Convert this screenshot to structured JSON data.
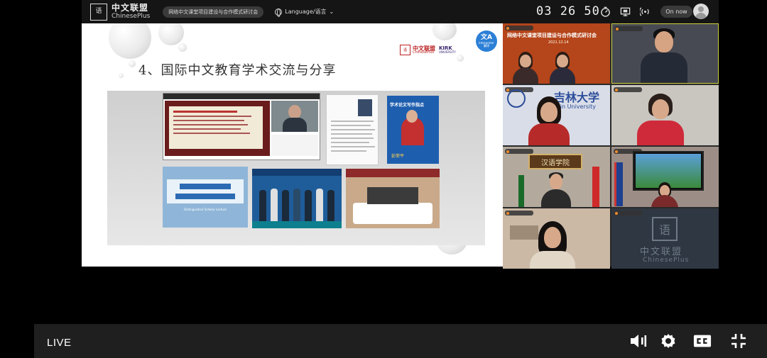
{
  "topbar": {
    "logo_seal": "ChinesePlus",
    "logo_cn": "中文联盟",
    "logo_en": "ChinesePlus",
    "meeting_title": "网络中文课堂项目建设与合作模式研讨会",
    "language_label": "Language/语言",
    "timer": "03 26 50",
    "on_now_label": "On now",
    "icons": [
      "language-icon",
      "chevron-down-icon",
      "stopwatch-icon",
      "screen-share-icon",
      "signal-icon",
      "user-avatar-icon"
    ]
  },
  "slide": {
    "title": "4、国际中文教育学术交流与分享",
    "logo_cn": "中文联盟",
    "logo_en": "ChinesePlus",
    "kirk_label": "KIRK",
    "kirk_sub": "UNIVERSITY",
    "interpreter_label": "Interpreter",
    "interpreter_cn": "翻译",
    "poster_title": "学术论文写作指点",
    "poster_name": "彭荣平",
    "banner_photo_text": "Distinguished Scholar Lecture"
  },
  "video_tiles": [
    {
      "name": "tile-banner-conference",
      "banner_text": "网络中文课堂项目建设与合作模式研讨会",
      "date": "2021.12.14"
    },
    {
      "name": "tile-man-glasses"
    },
    {
      "name": "tile-jilin-university",
      "backdrop_cn": "吉林大学",
      "backdrop_en": "Jilin University"
    },
    {
      "name": "tile-woman-glasses"
    },
    {
      "name": "tile-man-flags",
      "plaque_text": "汉语学院"
    },
    {
      "name": "tile-school-screen"
    },
    {
      "name": "tile-woman-office"
    },
    {
      "name": "tile-chineseplus-placeholder",
      "logo_cn": "中文联盟",
      "logo_en": "ChinesePlus"
    }
  ],
  "player": {
    "live_label": "LIVE",
    "icons": [
      "volume-icon",
      "settings-gear-icon",
      "closed-captions-icon",
      "exit-fullscreen-icon"
    ]
  },
  "colors": {
    "topbar_bg": "#151515",
    "player_bg": "#1f1f1f",
    "interpreter_blue": "#2b7fd6",
    "brand_red": "#b22222"
  }
}
